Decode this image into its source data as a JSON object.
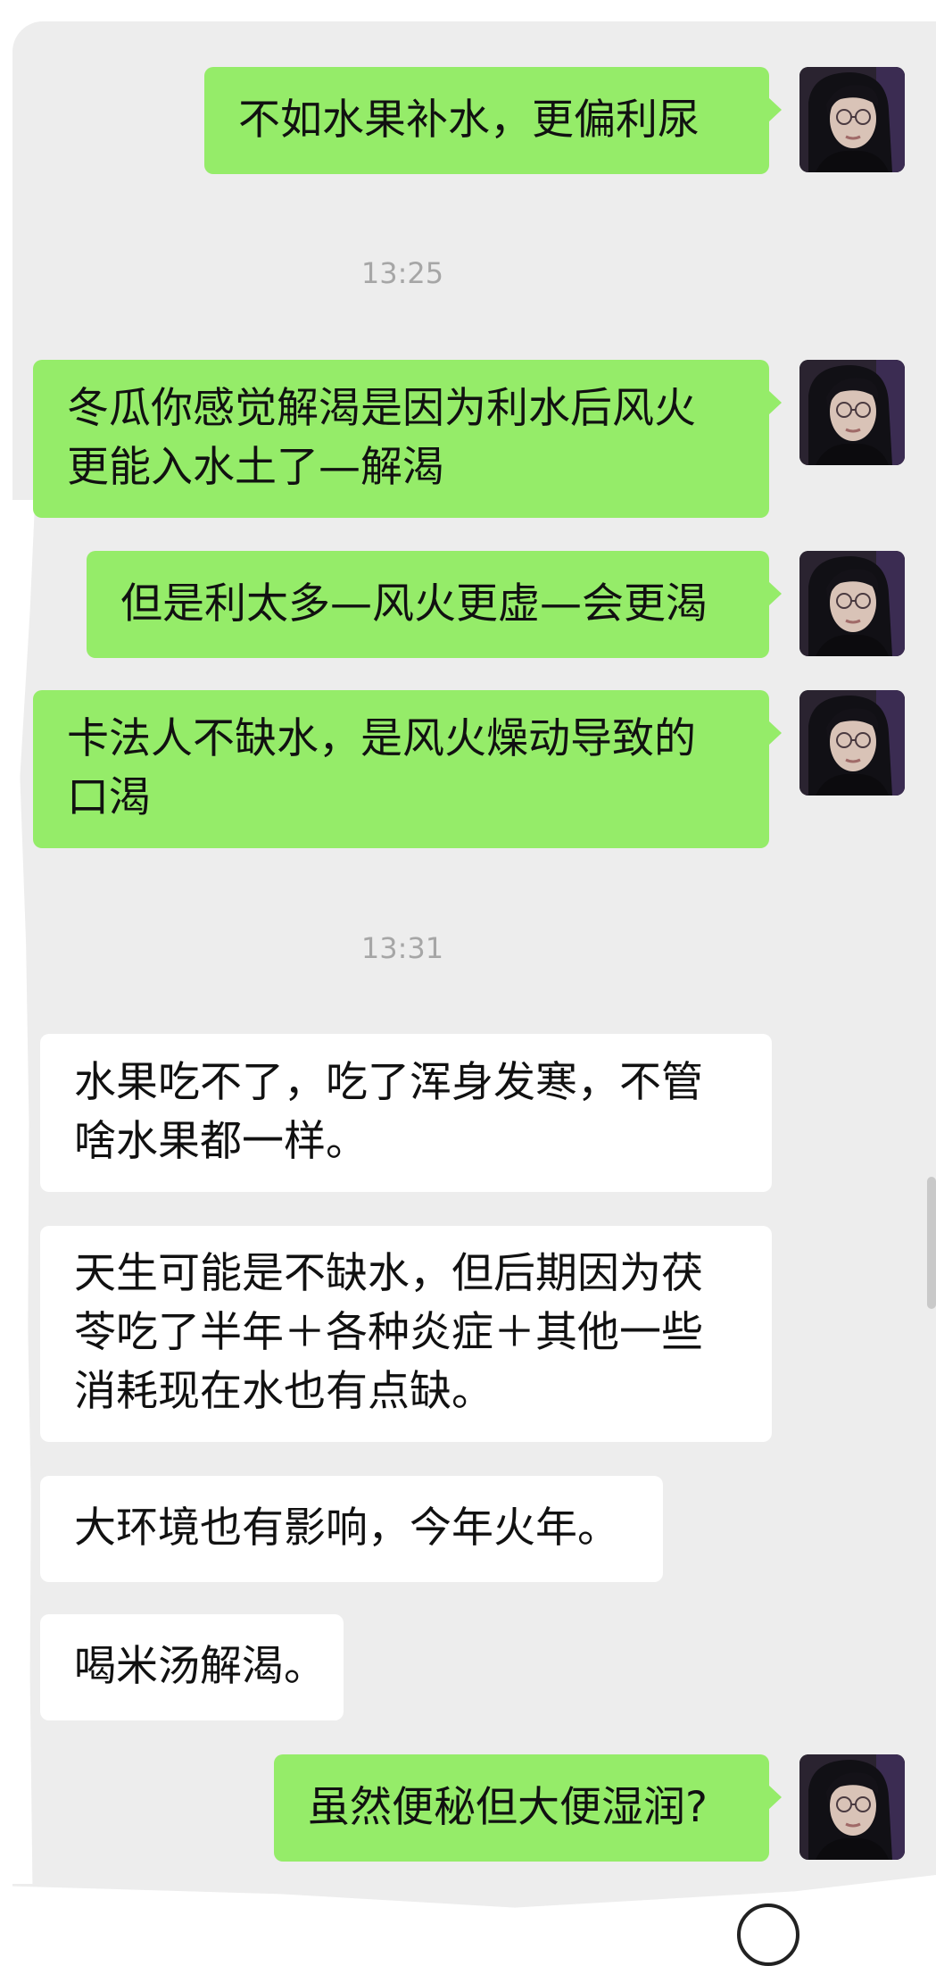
{
  "messages": [
    {
      "kind": "sent",
      "lines": [
        "不如水果补水，更偏利尿"
      ]
    },
    {
      "kind": "time",
      "text": "13:25"
    },
    {
      "kind": "sent",
      "lines": [
        "冬瓜你感觉解渴是因为利水后风火",
        "更能入水土了—解渴"
      ]
    },
    {
      "kind": "sent",
      "lines": [
        "但是利太多—风火更虚—会更渴"
      ]
    },
    {
      "kind": "sent",
      "lines": [
        "卡法人不缺水，是风火燥动导致的",
        "口渴"
      ]
    },
    {
      "kind": "time",
      "text": "13:31"
    },
    {
      "kind": "received",
      "lines": [
        "水果吃不了，吃了浑身发寒，不管",
        "啥水果都一样。"
      ]
    },
    {
      "kind": "received",
      "lines": [
        "天生可能是不缺水，但后期因为茯",
        "苓吃了半年＋各种炎症＋其他一些",
        "消耗现在水也有点缺。"
      ]
    },
    {
      "kind": "received",
      "lines": [
        "大环境也有影响，今年火年。"
      ]
    },
    {
      "kind": "received",
      "lines": [
        "喝米汤解渴。"
      ]
    },
    {
      "kind": "sent",
      "lines": [
        "虽然便秘但大便湿润?"
      ]
    }
  ],
  "colors": {
    "sent_bubble": "#95ec69",
    "received_bubble": "#ffffff",
    "chat_background": "#ededed",
    "timestamp": "#a6a6a6"
  },
  "icons": {
    "avatar": "user-avatar-photo"
  }
}
